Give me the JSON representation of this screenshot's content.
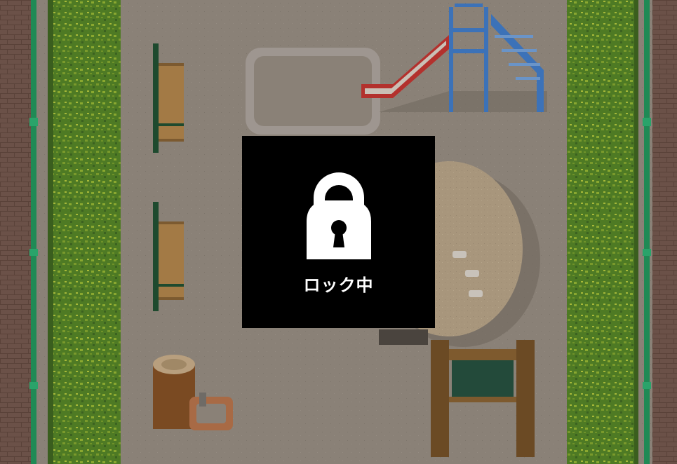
{
  "lock_overlay": {
    "icon": "padlock-icon",
    "label": "ロック中"
  },
  "colors": {
    "ground": "#8a8177",
    "hedge": "#4e7a24",
    "hedge_light": "#8aa830",
    "fence": "#1f8a55",
    "brick": "#6b5148",
    "slide_red": "#b3312d",
    "slide_blue": "#3c72b8",
    "overlay": "#000000",
    "lock_fill": "#ffffff"
  },
  "scene": {
    "objects": [
      "bench",
      "bench",
      "sandbox",
      "slide",
      "dome-climber",
      "sign-board",
      "tree-stump",
      "drinking-fountain",
      "hedge",
      "fence",
      "brick-wall"
    ]
  }
}
